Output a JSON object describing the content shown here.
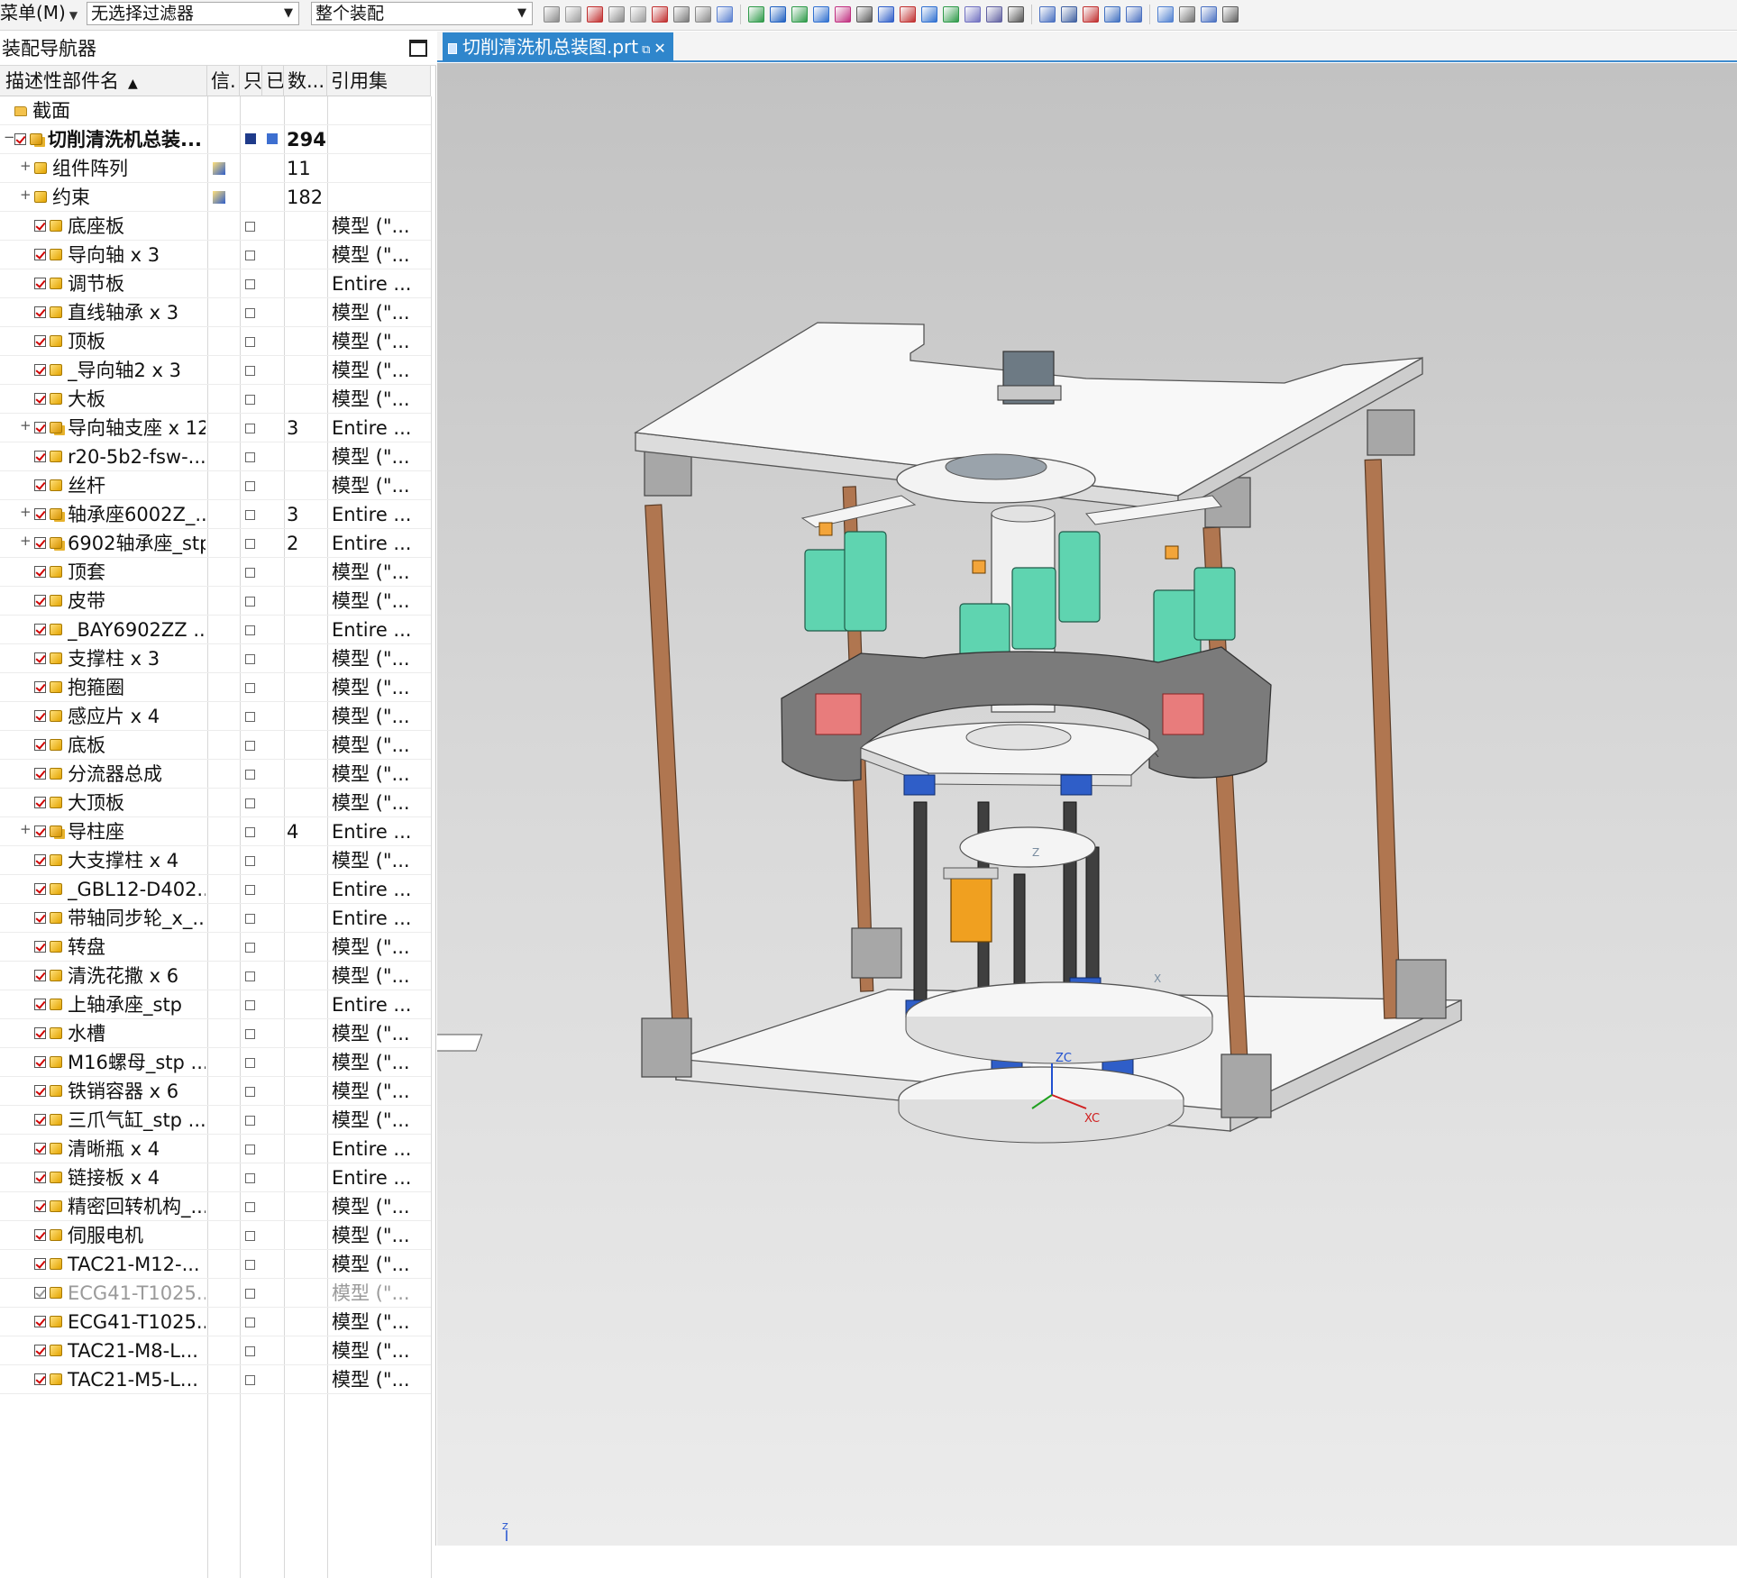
{
  "toolbar": {
    "menu_label": "菜单(M)",
    "filter_value": "无选择过滤器",
    "scope_value": "整个装配"
  },
  "navigator": {
    "title": "装配导航器",
    "columns": {
      "name": "描述性部件名",
      "info": "信.",
      "readonly": "只",
      "modified": "已",
      "qty": "数...",
      "refset": "引用集"
    },
    "rows": [
      {
        "level": 0,
        "type": "folder",
        "name": "截面",
        "qty": "",
        "ref": "",
        "check": false,
        "expander": "none"
      },
      {
        "level": 0,
        "type": "assembly",
        "name": "切削清洗机总装...",
        "qty": "294",
        "ref": "",
        "check": true,
        "expander": "minus",
        "bold": true
      },
      {
        "level": 1,
        "type": "array",
        "name": "组件阵列",
        "qty": "11",
        "ref": "",
        "check": false,
        "expander": "plus"
      },
      {
        "level": 1,
        "type": "constraint",
        "name": "约束",
        "qty": "182",
        "ref": "",
        "check": false,
        "expander": "plus"
      },
      {
        "level": 1,
        "type": "part",
        "name": "底座板",
        "qty": "",
        "ref": "模型 (\"...",
        "check": true
      },
      {
        "level": 1,
        "type": "part",
        "name": "导向轴 x 3",
        "qty": "",
        "ref": "模型 (\"...",
        "check": true
      },
      {
        "level": 1,
        "type": "part",
        "name": "调节板",
        "qty": "",
        "ref": "Entire ...",
        "check": true
      },
      {
        "level": 1,
        "type": "part",
        "name": "直线轴承 x 3",
        "qty": "",
        "ref": "模型 (\"...",
        "check": true
      },
      {
        "level": 1,
        "type": "part",
        "name": "顶板",
        "qty": "",
        "ref": "模型 (\"...",
        "check": true
      },
      {
        "level": 1,
        "type": "part",
        "name": "_导向轴2 x 3",
        "qty": "",
        "ref": "模型 (\"...",
        "check": true
      },
      {
        "level": 1,
        "type": "part",
        "name": "大板",
        "qty": "",
        "ref": "模型 (\"...",
        "check": true
      },
      {
        "level": 1,
        "type": "assembly",
        "name": "导向轴支座 x 12",
        "qty": "3",
        "ref": "Entire ...",
        "check": true,
        "expander": "plus"
      },
      {
        "level": 1,
        "type": "part",
        "name": "r20-5b2-fsw-...",
        "qty": "",
        "ref": "模型 (\"...",
        "check": true
      },
      {
        "level": 1,
        "type": "part",
        "name": "丝杆",
        "qty": "",
        "ref": "模型 (\"...",
        "check": true
      },
      {
        "level": 1,
        "type": "assembly",
        "name": "轴承座6002Z_...",
        "qty": "3",
        "ref": "Entire ...",
        "check": true,
        "expander": "plus"
      },
      {
        "level": 1,
        "type": "assembly",
        "name": "6902轴承座_stp",
        "qty": "2",
        "ref": "Entire ...",
        "check": true,
        "expander": "plus"
      },
      {
        "level": 1,
        "type": "part",
        "name": "顶套",
        "qty": "",
        "ref": "模型 (\"...",
        "check": true
      },
      {
        "level": 1,
        "type": "part",
        "name": "皮带",
        "qty": "",
        "ref": "模型 (\"...",
        "check": true
      },
      {
        "level": 1,
        "type": "part",
        "name": "_BAY6902ZZ ...",
        "qty": "",
        "ref": "Entire ...",
        "check": true
      },
      {
        "level": 1,
        "type": "part",
        "name": "支撑柱 x 3",
        "qty": "",
        "ref": "模型 (\"...",
        "check": true
      },
      {
        "level": 1,
        "type": "part",
        "name": "抱箍圈",
        "qty": "",
        "ref": "模型 (\"...",
        "check": true
      },
      {
        "level": 1,
        "type": "part",
        "name": "感应片 x 4",
        "qty": "",
        "ref": "模型 (\"...",
        "check": true
      },
      {
        "level": 1,
        "type": "part",
        "name": "底板",
        "qty": "",
        "ref": "模型 (\"...",
        "check": true
      },
      {
        "level": 1,
        "type": "part",
        "name": "分流器总成",
        "qty": "",
        "ref": "模型 (\"...",
        "check": true
      },
      {
        "level": 1,
        "type": "part",
        "name": "大顶板",
        "qty": "",
        "ref": "模型 (\"...",
        "check": true
      },
      {
        "level": 1,
        "type": "assembly",
        "name": "导柱座",
        "qty": "4",
        "ref": "Entire ...",
        "check": true,
        "expander": "plus"
      },
      {
        "level": 1,
        "type": "part",
        "name": "大支撑柱 x 4",
        "qty": "",
        "ref": "模型 (\"...",
        "check": true
      },
      {
        "level": 1,
        "type": "part",
        "name": "_GBL12-D402...",
        "qty": "",
        "ref": "Entire ...",
        "check": true
      },
      {
        "level": 1,
        "type": "part",
        "name": "带轴同步轮_x_...",
        "qty": "",
        "ref": "Entire ...",
        "check": true
      },
      {
        "level": 1,
        "type": "part",
        "name": "转盘",
        "qty": "",
        "ref": "模型 (\"...",
        "check": true
      },
      {
        "level": 1,
        "type": "part",
        "name": "清洗花撒 x 6",
        "qty": "",
        "ref": "模型 (\"...",
        "check": true
      },
      {
        "level": 1,
        "type": "part",
        "name": "上轴承座_stp",
        "qty": "",
        "ref": "Entire ...",
        "check": true
      },
      {
        "level": 1,
        "type": "part",
        "name": "水槽",
        "qty": "",
        "ref": "模型 (\"...",
        "check": true
      },
      {
        "level": 1,
        "type": "part",
        "name": "M16螺母_stp ...",
        "qty": "",
        "ref": "模型 (\"...",
        "check": true
      },
      {
        "level": 1,
        "type": "part",
        "name": "铁销容器 x 6",
        "qty": "",
        "ref": "模型 (\"...",
        "check": true
      },
      {
        "level": 1,
        "type": "part",
        "name": "三爪气缸_stp ...",
        "qty": "",
        "ref": "模型 (\"...",
        "check": true
      },
      {
        "level": 1,
        "type": "part",
        "name": "清晰瓶 x 4",
        "qty": "",
        "ref": "Entire ...",
        "check": true
      },
      {
        "level": 1,
        "type": "part",
        "name": "链接板 x 4",
        "qty": "",
        "ref": "Entire ...",
        "check": true
      },
      {
        "level": 1,
        "type": "part",
        "name": "精密回转机构_...",
        "qty": "",
        "ref": "模型 (\"...",
        "check": true
      },
      {
        "level": 1,
        "type": "part",
        "name": "伺服电机",
        "qty": "",
        "ref": "模型 (\"...",
        "check": true
      },
      {
        "level": 1,
        "type": "part",
        "name": "TAC21-M12-...",
        "qty": "",
        "ref": "模型 (\"...",
        "check": true
      },
      {
        "level": 1,
        "type": "part",
        "name": "ECG41-T1025...",
        "qty": "",
        "ref": "模型 (\"...",
        "check": false,
        "dim": true
      },
      {
        "level": 1,
        "type": "part",
        "name": "ECG41-T1025...",
        "qty": "",
        "ref": "模型 (\"...",
        "check": true
      },
      {
        "level": 1,
        "type": "part",
        "name": "TAC21-M8-L...",
        "qty": "",
        "ref": "模型 (\"...",
        "check": true
      },
      {
        "level": 1,
        "type": "part",
        "name": "TAC21-M5-L...",
        "qty": "",
        "ref": "模型 (\"...",
        "check": true
      }
    ]
  },
  "graphics": {
    "tab_title": "切削清洗机总装图.prt",
    "triad_labels": {
      "zc": "ZC",
      "xc": "XC",
      "z": "Z",
      "x": "X"
    },
    "colors": {
      "plate": "#f7f7f7",
      "plate_edge": "#5a5a5a",
      "column": "#b07650",
      "post_block": "#9e9e9e",
      "bottle": "#5fd4b0",
      "tank": "#7a7a7a",
      "tank_inner": "#e8787a",
      "leadscrew": "#3d3d3d",
      "bearing_blue": "#2f5ec8",
      "motor": "#f0a020",
      "accent": "#2f86cc"
    },
    "icons": [
      "hide-icon",
      "select-icon",
      "snap-icon",
      "point-icon",
      "line-icon",
      "curve-icon",
      "circle-icon",
      "view-icon",
      "render-icon"
    ]
  }
}
